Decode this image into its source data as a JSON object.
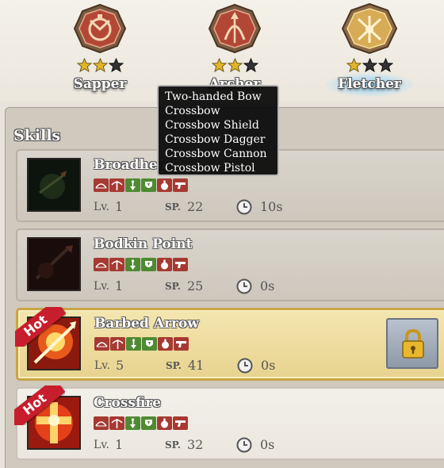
{
  "classes": [
    {
      "name": "Sapper",
      "stars_filled": 2,
      "stars_total": 3,
      "emblem": "sapper-emblem-icon",
      "selected": false
    },
    {
      "name": "Archer",
      "stars_filled": 2,
      "stars_total": 3,
      "emblem": "archer-emblem-icon",
      "selected": false
    },
    {
      "name": "Fletcher",
      "stars_filled": 1,
      "stars_total": 3,
      "emblem": "fletcher-emblem-icon",
      "selected": true
    }
  ],
  "tooltip": {
    "lines": [
      "Two-handed Bow",
      "Crossbow",
      "Crossbow Shield",
      "Crossbow Dagger",
      "Crossbow Cannon",
      "Crossbow Pistol"
    ]
  },
  "skills_section": {
    "title": "Skills"
  },
  "weapon_icons": [
    "two-handed-bow-icon",
    "crossbow-icon",
    "crossbow-shield-icon",
    "crossbow-dagger-icon",
    "crossbow-cannon-icon",
    "crossbow-pistol-icon"
  ],
  "skills": [
    {
      "name": "Broadhead",
      "lv_label": "Lv.",
      "level": "1",
      "sp_label": "SP.",
      "sp": "22",
      "cooldown": "10s",
      "hot": false,
      "locked": false,
      "icon": "broadhead-skill-icon"
    },
    {
      "name": "Bodkin Point",
      "lv_label": "Lv.",
      "level": "1",
      "sp_label": "SP.",
      "sp": "25",
      "cooldown": "0s",
      "hot": false,
      "locked": false,
      "icon": "bodkin-point-skill-icon"
    },
    {
      "name": "Barbed Arrow",
      "lv_label": "Lv.",
      "level": "5",
      "sp_label": "SP.",
      "sp": "41",
      "cooldown": "0s",
      "hot": true,
      "hot_label": "Hot",
      "locked": true,
      "icon": "barbed-arrow-skill-icon"
    },
    {
      "name": "Crossfire",
      "lv_label": "Lv.",
      "level": "1",
      "sp_label": "SP.",
      "sp": "32",
      "cooldown": "0s",
      "hot": true,
      "hot_label": "Hot",
      "locked": false,
      "icon": "crossfire-skill-icon"
    }
  ],
  "colors": {
    "star_gold": "#e0b52b",
    "star_empty": "#333333",
    "weapon_red": "#a63a32",
    "weapon_green": "#4f8a33",
    "hot_red": "#c81d2c"
  }
}
